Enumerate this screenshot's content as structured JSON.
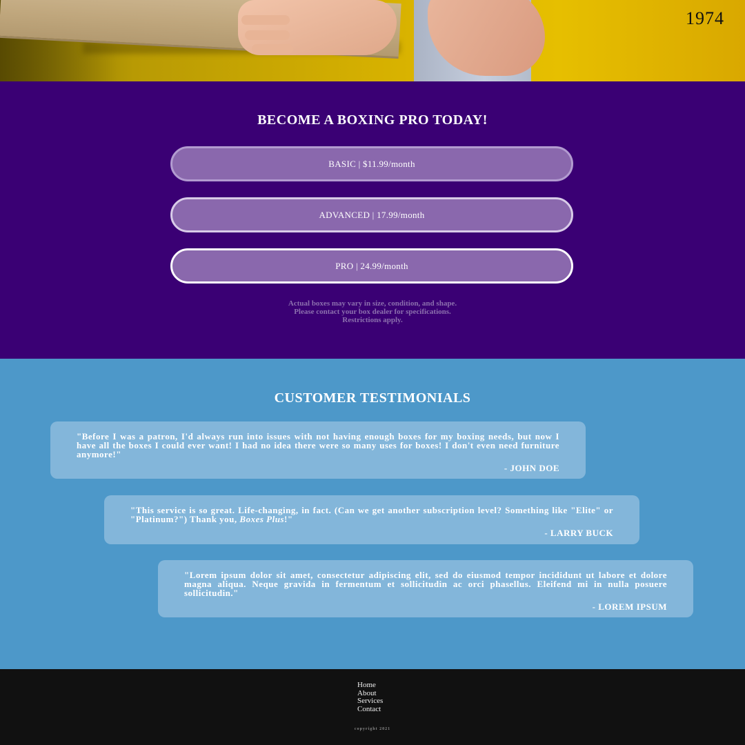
{
  "hero": {
    "year": "1974"
  },
  "pricing": {
    "heading": "BECOME A BOXING PRO TODAY!",
    "plans": [
      {
        "label": "BASIC | $11.99/month"
      },
      {
        "label": "ADVANCED | 17.99/month"
      },
      {
        "label": "PRO | 24.99/month"
      }
    ],
    "disclaimer": [
      "Actual boxes may vary in size, condition, and shape.",
      "Please contact your box dealer for specifications.",
      "Restrictions apply."
    ]
  },
  "testimonials": {
    "heading": "CUSTOMER TESTIMONIALS",
    "items": [
      {
        "quote": "\"Before I was a patron, I'd always run into issues with not having enough boxes for my boxing needs, but now I have all the boxes I could ever want! I had no idea there were so many uses for boxes! I don't even need furniture anymore!\"",
        "author": "- JOHN DOE"
      },
      {
        "quote_pre": "\"This service is so great. Life-changing, in fact. (Can we get another subscription level? Something like \"Elite\" or \"Platinum?\") Thank you, ",
        "quote_em": "Boxes Plus",
        "quote_post": "!\"",
        "author": "- LARRY BUCK"
      },
      {
        "quote": "\"Lorem ipsum dolor sit amet, consectetur adipiscing elit, sed do eiusmod tempor incididunt ut labore et dolore magna aliqua. Neque gravida in fermentum et sollicitudin ac orci phasellus. Eleifend mi in nulla posuere sollicitudin.\"",
        "author": "- LOREM IPSUM"
      }
    ]
  },
  "footer": {
    "links": [
      "Home",
      "About",
      "Services",
      "Contact"
    ],
    "copyright": "copyright 2021"
  },
  "colors": {
    "pricing_bg": "#3a0074",
    "plan_bg": "#8a68ad",
    "testimonials_bg": "#4d98c9",
    "card_bg": "#83b6da",
    "footer_bg": "#111111"
  }
}
